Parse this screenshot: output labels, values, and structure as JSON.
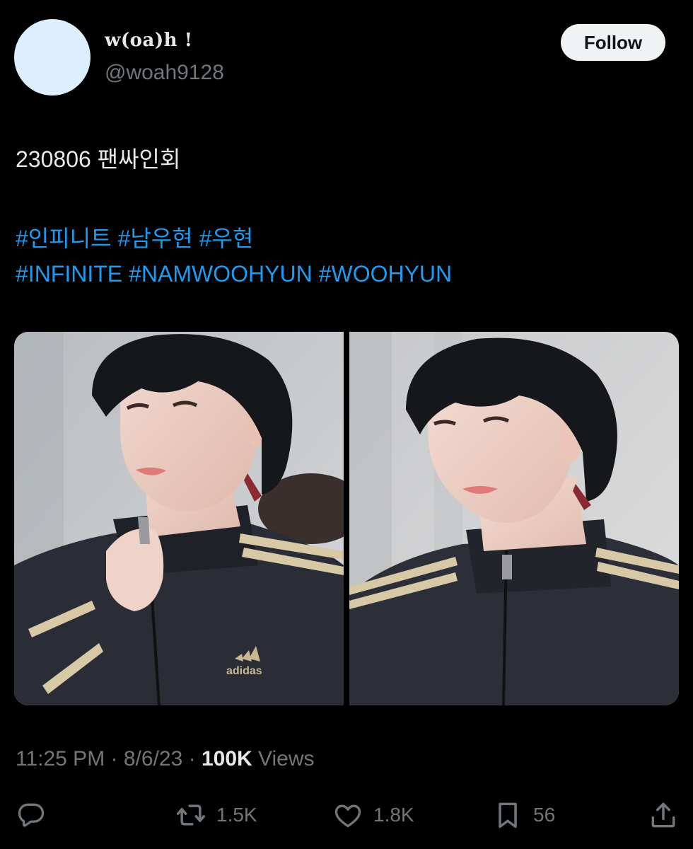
{
  "author": {
    "display_name": "w(oa)h !",
    "handle": "@woah9128"
  },
  "follow_label": "Follow",
  "tweet": {
    "text": "230806 팬싸인회",
    "hashtags_line1": [
      "#인피니트",
      "#남우현",
      "#우현"
    ],
    "hashtags_line2": [
      "#INFINITE",
      "#NAMWOOHYUN",
      "#WOOHYUN"
    ]
  },
  "meta": {
    "time": "11:25 PM",
    "separator": "·",
    "date": "8/6/23",
    "views_count": "100K",
    "views_label": "Views"
  },
  "actions": {
    "reply": {
      "icon": "reply-icon",
      "count": ""
    },
    "retweet": {
      "icon": "retweet-icon",
      "count": "1.5K"
    },
    "like": {
      "icon": "heart-icon",
      "count": "1.8K"
    },
    "bookmark": {
      "icon": "bookmark-icon",
      "count": "56"
    },
    "share": {
      "icon": "share-icon",
      "count": ""
    }
  },
  "media": {
    "logo_text": "adidas"
  },
  "colors": {
    "background": "#000000",
    "text": "#e7e9ea",
    "secondary": "#71767b",
    "link": "#1d9bf0",
    "avatar": "#ddeeff",
    "follow_bg": "#eff3f4"
  }
}
